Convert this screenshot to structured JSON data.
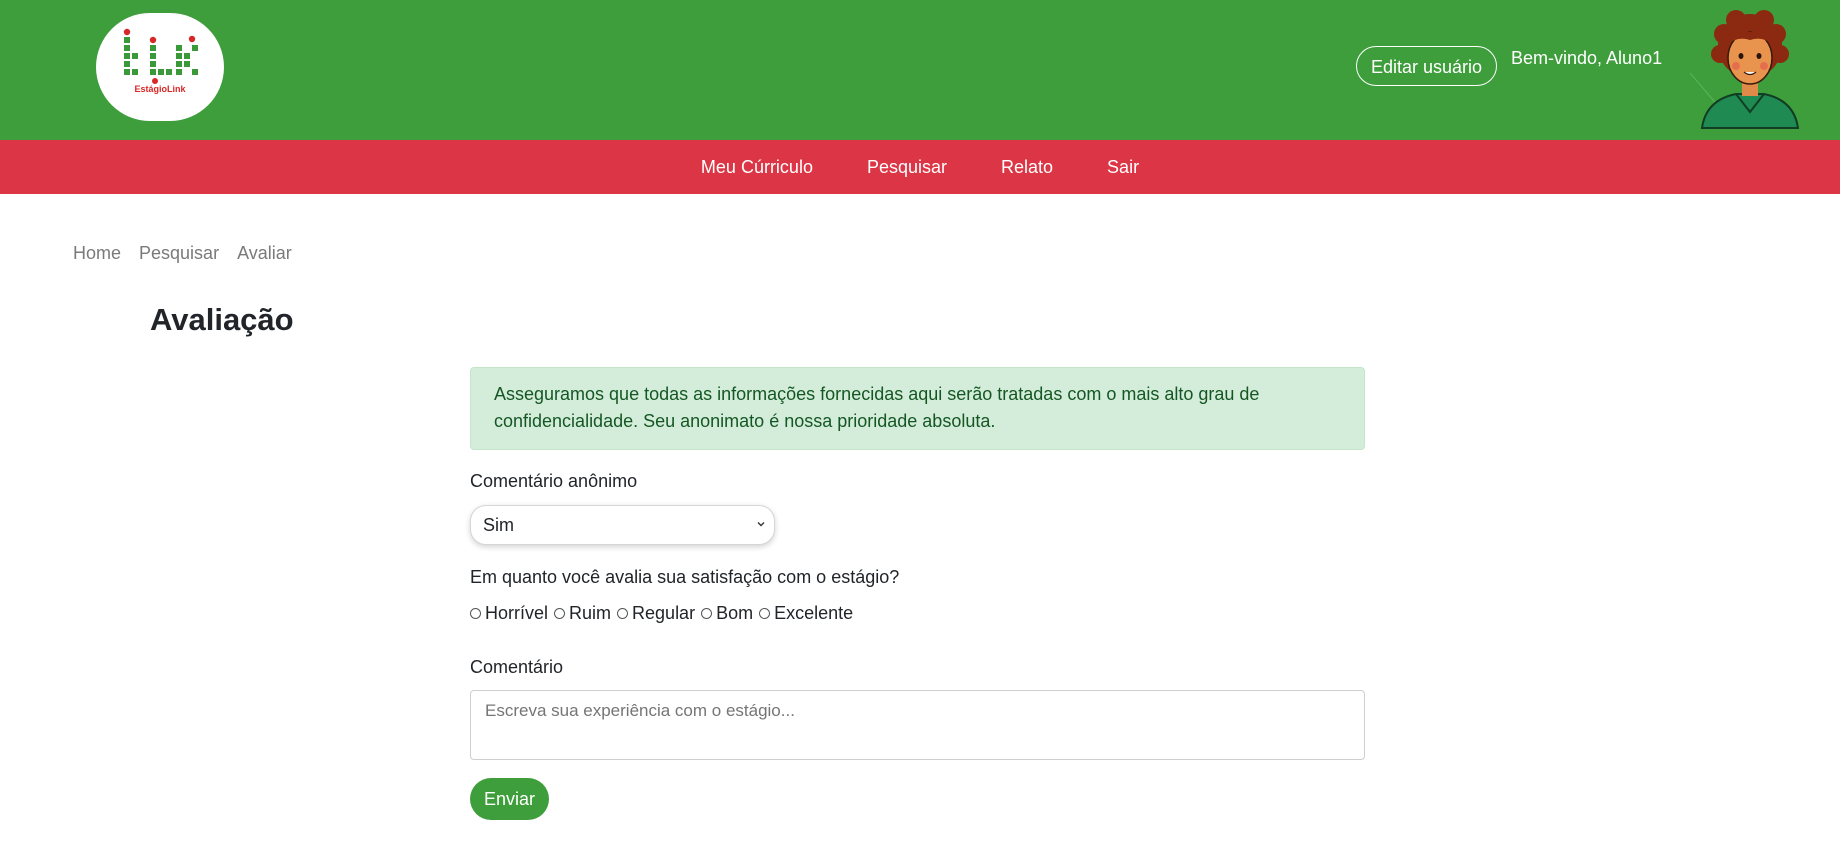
{
  "header": {
    "logo_text": "EstágioLink",
    "edit_user_label": "Editar usuário",
    "welcome_text": "Bem-vindo, Aluno1"
  },
  "nav": {
    "items": [
      {
        "label": "Meu Cúrriculo"
      },
      {
        "label": "Pesquisar"
      },
      {
        "label": "Relato"
      },
      {
        "label": "Sair"
      }
    ]
  },
  "breadcrumb": [
    "Home",
    "Pesquisar",
    "Avaliar"
  ],
  "page": {
    "title": "Avaliação",
    "alert": "Asseguramos que todas as informações fornecidas aqui serão tratadas com o mais alto grau de confidencialidade. Seu anonimato é nossa prioridade absoluta.",
    "anon_label": "Comentário anônimo",
    "anon_selected": "Sim",
    "question": "Em quanto você avalia sua satisfação com o estágio?",
    "ratings": [
      "Horrível",
      "Ruim",
      "Regular",
      "Bom",
      "Excelente"
    ],
    "comment_label": "Comentário",
    "comment_placeholder": "Escreva sua experiência com o estágio...",
    "submit_label": "Enviar"
  },
  "colors": {
    "header_green": "#3e9e3b",
    "nav_red": "#dc3545",
    "alert_bg": "#d4edda",
    "alert_text": "#155724"
  }
}
